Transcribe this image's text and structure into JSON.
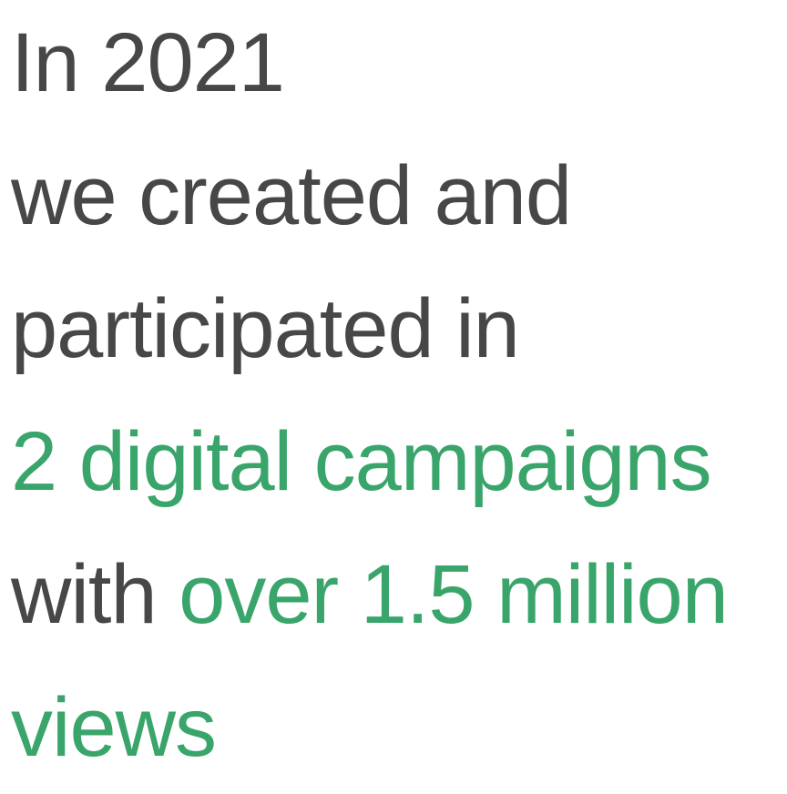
{
  "colors": {
    "text": "#474747",
    "accent": "#3aa56b",
    "background": "#ffffff"
  },
  "statement": {
    "line1": "In 2021",
    "line2": "we created and",
    "line3": "participated in",
    "line4_highlight": "2 digital campaigns",
    "line5_prefix": "with ",
    "line5_highlight": "over 1.5 million",
    "line6_highlight": "views"
  }
}
